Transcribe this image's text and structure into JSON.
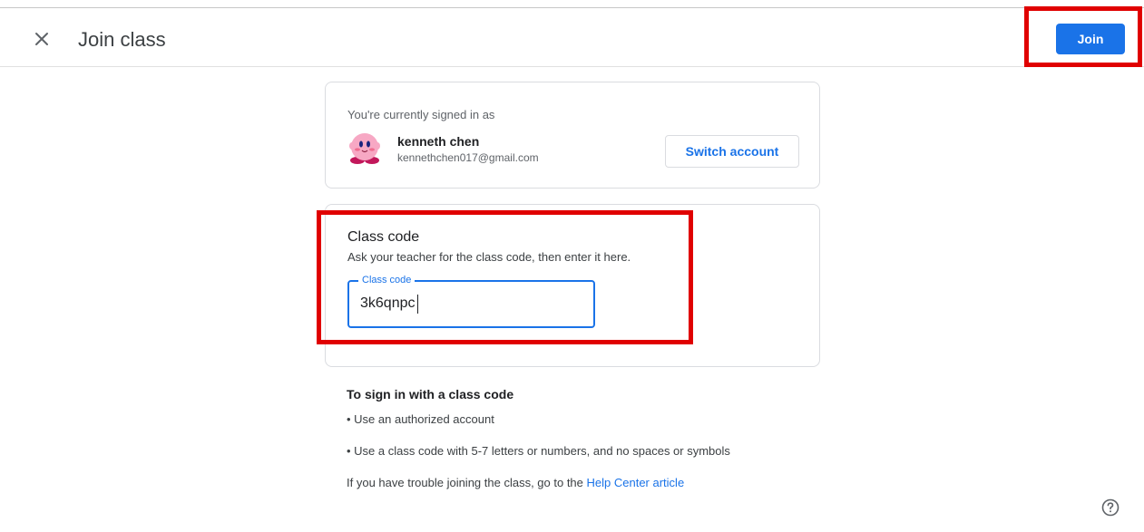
{
  "header": {
    "title": "Join class",
    "join_label": "Join",
    "close_icon": "close-icon"
  },
  "account": {
    "signed_in_label": "You're currently signed in as",
    "name": "kenneth chen",
    "email": "kennethchen017@gmail.com",
    "switch_label": "Switch account",
    "avatar_icon": "avatar-character-icon"
  },
  "class_code": {
    "title": "Class code",
    "description": "Ask your teacher for the class code, then enter it here.",
    "field_label": "Class code",
    "value": "3k6qnpc"
  },
  "info": {
    "heading": "To sign in with a class code",
    "bullets": [
      "• Use an authorized account",
      "• Use a class code with 5-7 letters or numbers, and no spaces or symbols"
    ],
    "trouble_text": "If you have trouble joining the class, go to the ",
    "help_link": "Help Center article"
  },
  "help_icon": "help-circle-icon",
  "colors": {
    "accent": "#1a73e8",
    "highlight": "#e00000"
  }
}
